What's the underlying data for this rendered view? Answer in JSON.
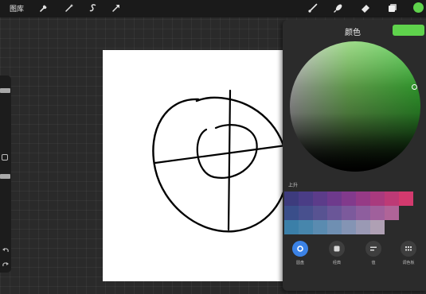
{
  "topbar": {
    "gallery_label": "图库",
    "left_icons": [
      "wrench-icon",
      "magic-wand-icon",
      "selection-s-icon",
      "arrow-transform-icon"
    ],
    "right_icons": [
      "brush-icon",
      "smudge-icon",
      "eraser-icon",
      "layers-icon"
    ],
    "current_color": "#5fd34c"
  },
  "color_panel": {
    "title": "颜色",
    "current_color": "#5fd34c",
    "history_label": "上升",
    "tabs": [
      {
        "icon": "disc-icon",
        "label": "圆盘",
        "active": true
      },
      {
        "icon": "classic-icon",
        "label": "经典",
        "active": false
      },
      {
        "icon": "value-icon",
        "label": "值",
        "active": false
      },
      {
        "icon": "palettes-icon",
        "label": "调色板",
        "active": false
      }
    ],
    "palette_rows": [
      [
        "#3d3b7d",
        "#4a3d86",
        "#5c3c8a",
        "#6e3a8c",
        "#823a8c",
        "#963a86",
        "#a93a7e",
        "#bd3a76",
        "#d33a6e"
      ],
      [
        "#3a4e8a",
        "#48508e",
        "#585392",
        "#6a5698",
        "#7c5a9c",
        "#8e5e9e",
        "#a0609c",
        "#b06498"
      ],
      [
        "#3b7fa8",
        "#4786ac",
        "#5a8bb0",
        "#6f8fb2",
        "#8494b4",
        "#9a99b4",
        "#afa0b4"
      ]
    ]
  }
}
